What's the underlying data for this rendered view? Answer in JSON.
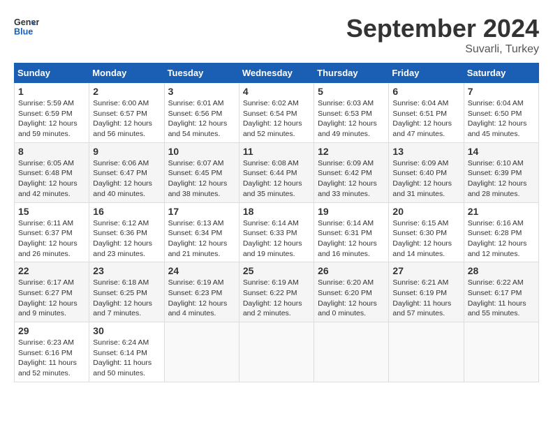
{
  "header": {
    "logo_line1": "General",
    "logo_line2": "Blue",
    "month": "September 2024",
    "location": "Suvarli, Turkey"
  },
  "columns": [
    "Sunday",
    "Monday",
    "Tuesday",
    "Wednesday",
    "Thursday",
    "Friday",
    "Saturday"
  ],
  "weeks": [
    [
      {
        "day": "1",
        "rise": "5:59 AM",
        "set": "6:59 PM",
        "daylight": "12 hours and 59 minutes."
      },
      {
        "day": "2",
        "rise": "6:00 AM",
        "set": "6:57 PM",
        "daylight": "12 hours and 56 minutes."
      },
      {
        "day": "3",
        "rise": "6:01 AM",
        "set": "6:56 PM",
        "daylight": "12 hours and 54 minutes."
      },
      {
        "day": "4",
        "rise": "6:02 AM",
        "set": "6:54 PM",
        "daylight": "12 hours and 52 minutes."
      },
      {
        "day": "5",
        "rise": "6:03 AM",
        "set": "6:53 PM",
        "daylight": "12 hours and 49 minutes."
      },
      {
        "day": "6",
        "rise": "6:04 AM",
        "set": "6:51 PM",
        "daylight": "12 hours and 47 minutes."
      },
      {
        "day": "7",
        "rise": "6:04 AM",
        "set": "6:50 PM",
        "daylight": "12 hours and 45 minutes."
      }
    ],
    [
      {
        "day": "8",
        "rise": "6:05 AM",
        "set": "6:48 PM",
        "daylight": "12 hours and 42 minutes."
      },
      {
        "day": "9",
        "rise": "6:06 AM",
        "set": "6:47 PM",
        "daylight": "12 hours and 40 minutes."
      },
      {
        "day": "10",
        "rise": "6:07 AM",
        "set": "6:45 PM",
        "daylight": "12 hours and 38 minutes."
      },
      {
        "day": "11",
        "rise": "6:08 AM",
        "set": "6:44 PM",
        "daylight": "12 hours and 35 minutes."
      },
      {
        "day": "12",
        "rise": "6:09 AM",
        "set": "6:42 PM",
        "daylight": "12 hours and 33 minutes."
      },
      {
        "day": "13",
        "rise": "6:09 AM",
        "set": "6:40 PM",
        "daylight": "12 hours and 31 minutes."
      },
      {
        "day": "14",
        "rise": "6:10 AM",
        "set": "6:39 PM",
        "daylight": "12 hours and 28 minutes."
      }
    ],
    [
      {
        "day": "15",
        "rise": "6:11 AM",
        "set": "6:37 PM",
        "daylight": "12 hours and 26 minutes."
      },
      {
        "day": "16",
        "rise": "6:12 AM",
        "set": "6:36 PM",
        "daylight": "12 hours and 23 minutes."
      },
      {
        "day": "17",
        "rise": "6:13 AM",
        "set": "6:34 PM",
        "daylight": "12 hours and 21 minutes."
      },
      {
        "day": "18",
        "rise": "6:14 AM",
        "set": "6:33 PM",
        "daylight": "12 hours and 19 minutes."
      },
      {
        "day": "19",
        "rise": "6:14 AM",
        "set": "6:31 PM",
        "daylight": "12 hours and 16 minutes."
      },
      {
        "day": "20",
        "rise": "6:15 AM",
        "set": "6:30 PM",
        "daylight": "12 hours and 14 minutes."
      },
      {
        "day": "21",
        "rise": "6:16 AM",
        "set": "6:28 PM",
        "daylight": "12 hours and 12 minutes."
      }
    ],
    [
      {
        "day": "22",
        "rise": "6:17 AM",
        "set": "6:27 PM",
        "daylight": "12 hours and 9 minutes."
      },
      {
        "day": "23",
        "rise": "6:18 AM",
        "set": "6:25 PM",
        "daylight": "12 hours and 7 minutes."
      },
      {
        "day": "24",
        "rise": "6:19 AM",
        "set": "6:23 PM",
        "daylight": "12 hours and 4 minutes."
      },
      {
        "day": "25",
        "rise": "6:19 AM",
        "set": "6:22 PM",
        "daylight": "12 hours and 2 minutes."
      },
      {
        "day": "26",
        "rise": "6:20 AM",
        "set": "6:20 PM",
        "daylight": "12 hours and 0 minutes."
      },
      {
        "day": "27",
        "rise": "6:21 AM",
        "set": "6:19 PM",
        "daylight": "11 hours and 57 minutes."
      },
      {
        "day": "28",
        "rise": "6:22 AM",
        "set": "6:17 PM",
        "daylight": "11 hours and 55 minutes."
      }
    ],
    [
      {
        "day": "29",
        "rise": "6:23 AM",
        "set": "6:16 PM",
        "daylight": "11 hours and 52 minutes."
      },
      {
        "day": "30",
        "rise": "6:24 AM",
        "set": "6:14 PM",
        "daylight": "11 hours and 50 minutes."
      },
      null,
      null,
      null,
      null,
      null
    ]
  ]
}
